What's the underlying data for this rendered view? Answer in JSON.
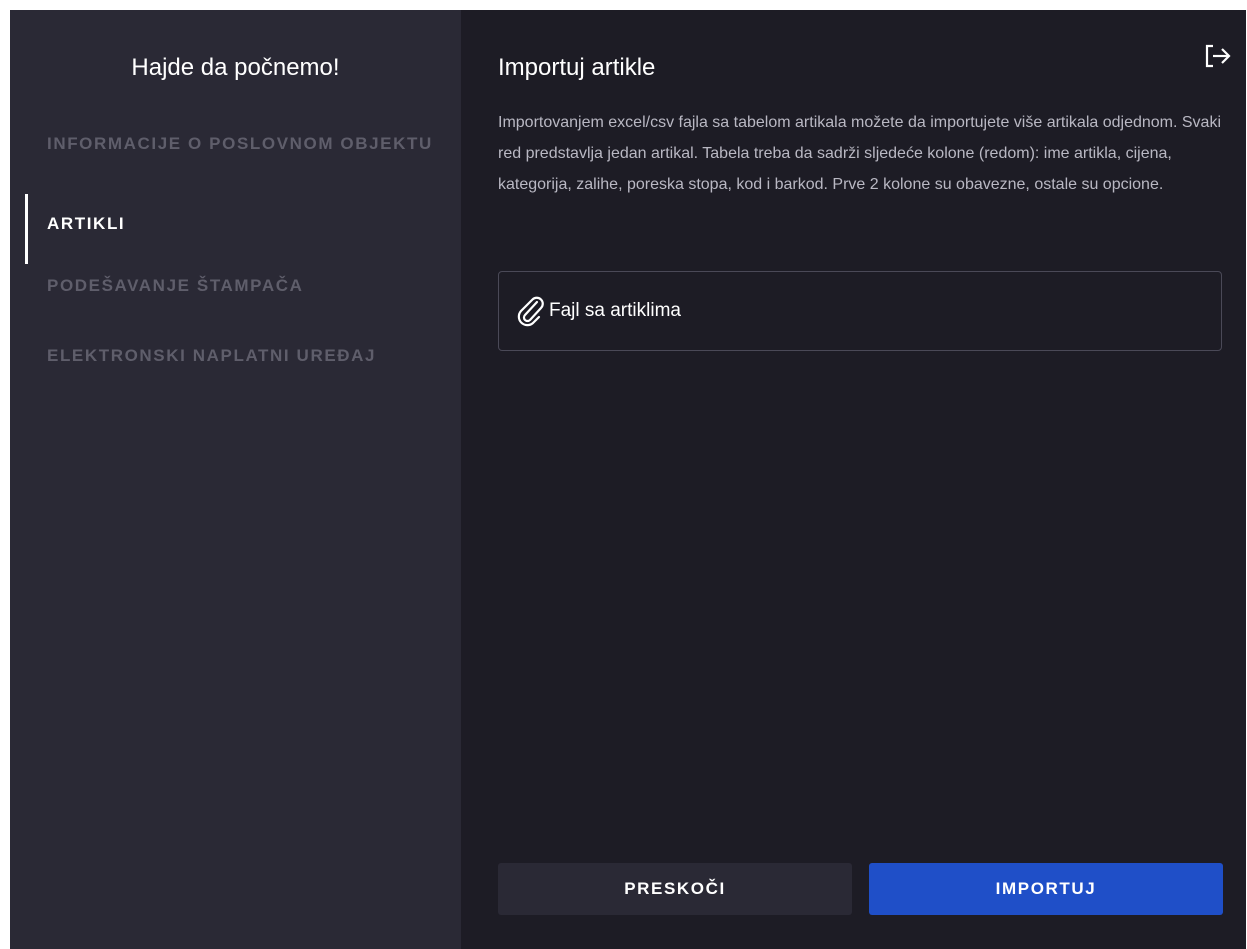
{
  "sidebar": {
    "title": "Hajde da počnemo!",
    "items": [
      {
        "label": "INFORMACIJE O POSLOVNOM OBJEKTU",
        "active": false
      },
      {
        "label": "ARTIKLI",
        "active": true
      },
      {
        "label": "PODEŠAVANJE ŠTAMPAČA",
        "active": false
      },
      {
        "label": "ELEKTRONSKI NAPLATNI UREĐAJ",
        "active": false
      }
    ]
  },
  "main": {
    "title": "Importuj artikle",
    "description": "Importovanjem excel/csv fajla sa tabelom artikala možete da importujete više artikala odjednom. Svaki red predstavlja jedan artikal. Tabela treba da sadrži sljedeće kolone (redom): ime artikla, cijena, kategorija, zalihe, poreska stopa, kod i barkod. Prve 2 kolone su obavezne, ostale su opcione.",
    "file_input_label": "Fajl sa artiklima",
    "file_icon": "paperclip-icon",
    "exit_icon": "logout-icon"
  },
  "buttons": {
    "skip_label": "PRESKOČI",
    "import_label": "IMPORTUJ"
  },
  "colors": {
    "sidebar_bg": "#2a2935",
    "main_bg": "#1d1c25",
    "accent": "#1f4fc8",
    "inactive_text": "#5f5e6b",
    "active_text": "#ffffff"
  }
}
